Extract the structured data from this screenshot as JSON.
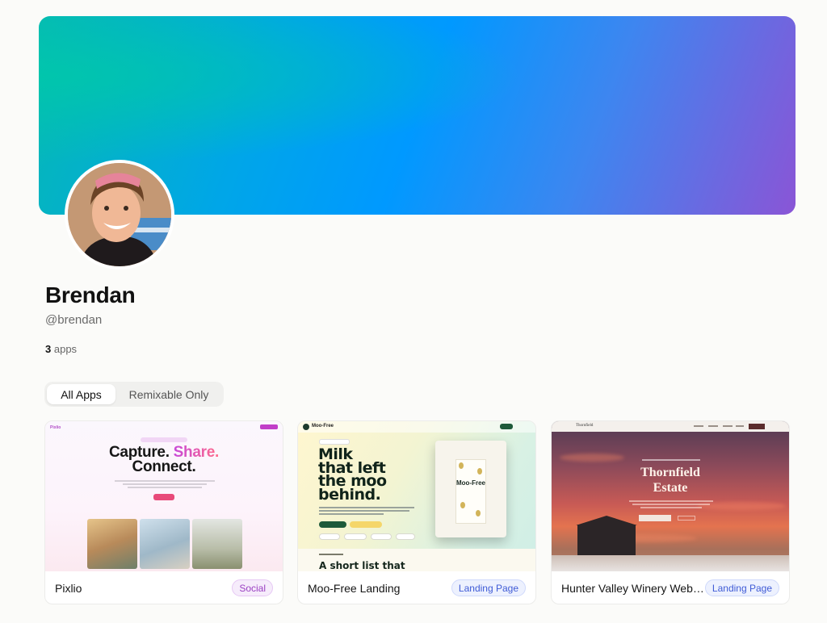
{
  "profile": {
    "name": "Brendan",
    "handle": "@brendan",
    "app_count": "3",
    "app_count_label": "apps",
    "avatar_icon": "profile-photo",
    "banner_colors": [
      "#06b9b4",
      "#0099ff",
      "#8a55d6"
    ]
  },
  "filters": {
    "all_label": "All Apps",
    "remixable_label": "Remixable Only",
    "active": "All Apps"
  },
  "apps": [
    {
      "title": "Pixlio",
      "badge": "Social",
      "thumb": {
        "logo": "Pixlio",
        "headline_1": "Capture.",
        "headline_2": "Share.",
        "headline_3": "Connect."
      }
    },
    {
      "title": "Moo-Free Landing",
      "badge": "Landing Page",
      "thumb": {
        "brand": "Moo-Free",
        "headline": "Milk\nthat left\nthe moo\nbehind.",
        "pack_label": "Moo-Free",
        "lower_heading": "A short list that"
      }
    },
    {
      "title": "Hunter Valley Winery Web…",
      "badge": "Landing Page",
      "thumb": {
        "logo": "Thornfield",
        "headline": "Thornfield\nEstate"
      }
    }
  ]
}
